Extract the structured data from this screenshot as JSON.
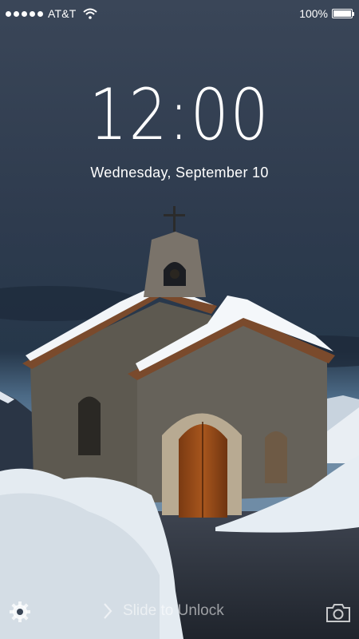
{
  "status_bar": {
    "carrier": "AT&T",
    "signal_bars": 5,
    "battery_text": "100%",
    "battery_level": 1.0
  },
  "lock_screen": {
    "time": "12:00",
    "date": "Wednesday, September 10",
    "slide_to_unlock": "Slide to Unlock"
  },
  "icons": {
    "settings": "gear-icon",
    "camera": "camera-icon",
    "wifi": "wifi-icon",
    "chevron": "chevron-right-icon"
  },
  "colors": {
    "sky": "#2c3a4c",
    "text": "#ffffff"
  }
}
